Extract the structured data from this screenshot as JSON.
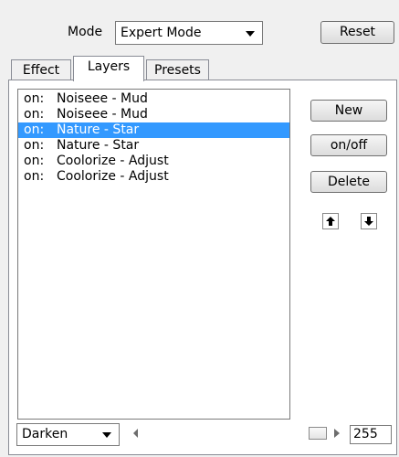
{
  "header": {
    "mode_label": "Mode",
    "mode_value": "Expert Mode",
    "reset_label": "Reset"
  },
  "tabs": [
    {
      "label": "Effect",
      "active": false
    },
    {
      "label": "Layers",
      "active": true
    },
    {
      "label": "Presets",
      "active": false
    }
  ],
  "layers": [
    {
      "state": "on:",
      "name": "Noiseee - Mud",
      "selected": false
    },
    {
      "state": "on:",
      "name": "Noiseee - Mud",
      "selected": false
    },
    {
      "state": "on:",
      "name": "Nature - Star",
      "selected": true
    },
    {
      "state": "on:",
      "name": "Nature - Star",
      "selected": false
    },
    {
      "state": "on:",
      "name": "Coolorize - Adjust",
      "selected": false
    },
    {
      "state": "on:",
      "name": "Coolorize - Adjust",
      "selected": false
    }
  ],
  "side_buttons": {
    "new_label": "New",
    "onoff_label": "on/off",
    "delete_label": "Delete"
  },
  "icons": {
    "move_up": "arrow-up-icon",
    "move_down": "arrow-down-icon"
  },
  "bottom": {
    "blend_mode": "Darken",
    "opacity_value": "255",
    "opacity_fraction": 1.0
  },
  "colors": {
    "selection": "#3399ff",
    "window": "#f0f0f0"
  }
}
